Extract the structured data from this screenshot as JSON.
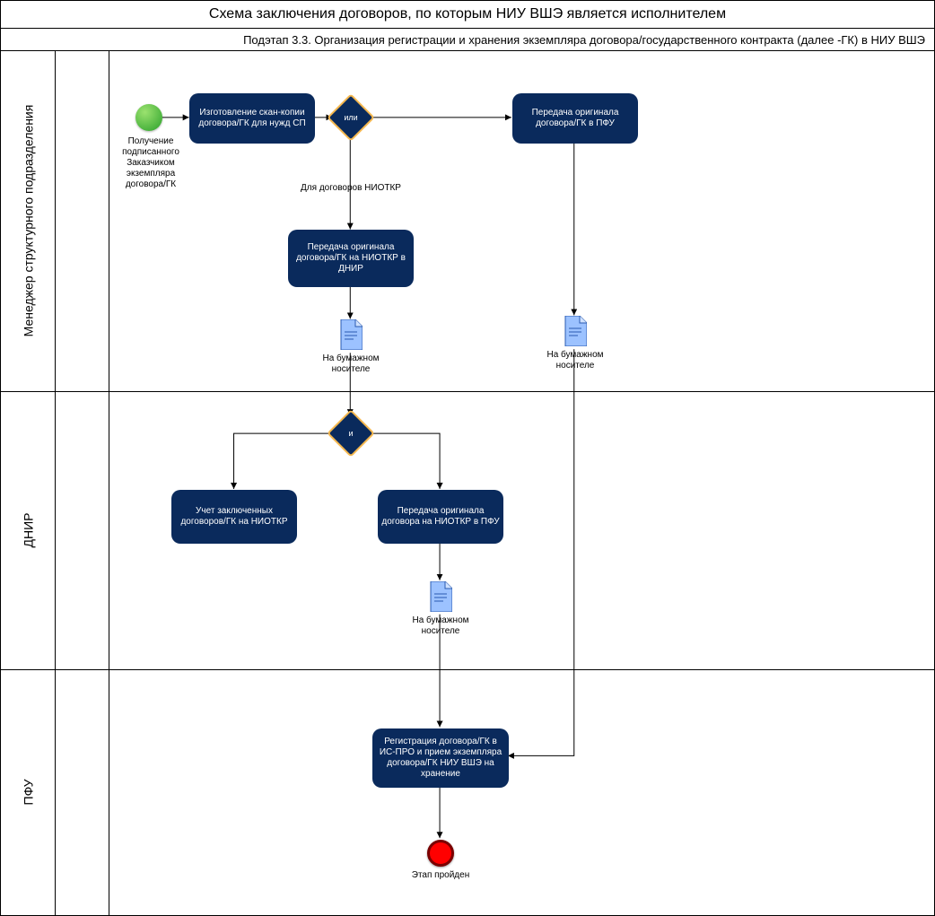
{
  "title": "Схема заключения договоров, по которым НИУ ВШЭ является исполнителем",
  "subtitle": "Подэтап 3.3. Организация регистрации и хранения экземпляра  договора/государственного контракта (далее -ГК) в НИУ ВШЭ",
  "lanes": {
    "l1": "Менеджер структурного подразделения",
    "l2": "ДНИР",
    "l3": "ПФУ"
  },
  "start": {
    "label": "Получение подписанного Заказчиком экземпляра договора/ГК"
  },
  "tasks": {
    "scan": "Изготовление скан-копии договора/ГК для нужд СП",
    "toPFU": "Передача оригинала договора/ГК в ПФУ",
    "toDNIR": "Передача оригинала договора/ГК на НИОТКР в ДНИР",
    "accounting": "Учет заключенных договоров/ГК на НИОТКР",
    "passNIOTKR": "Передача оригинала договора на НИОТКР в ПФУ",
    "register": "Регистрация договора/ГК в ИС-ПРО и прием экземпляра договора/ГК НИУ ВШЭ на хранение"
  },
  "gateways": {
    "or": "или",
    "and": "и"
  },
  "annotations": {
    "niotkrPath": "Для договоров НИОТКР",
    "paper": "На бумажном носителе"
  },
  "end": {
    "label": "Этап пройден"
  }
}
